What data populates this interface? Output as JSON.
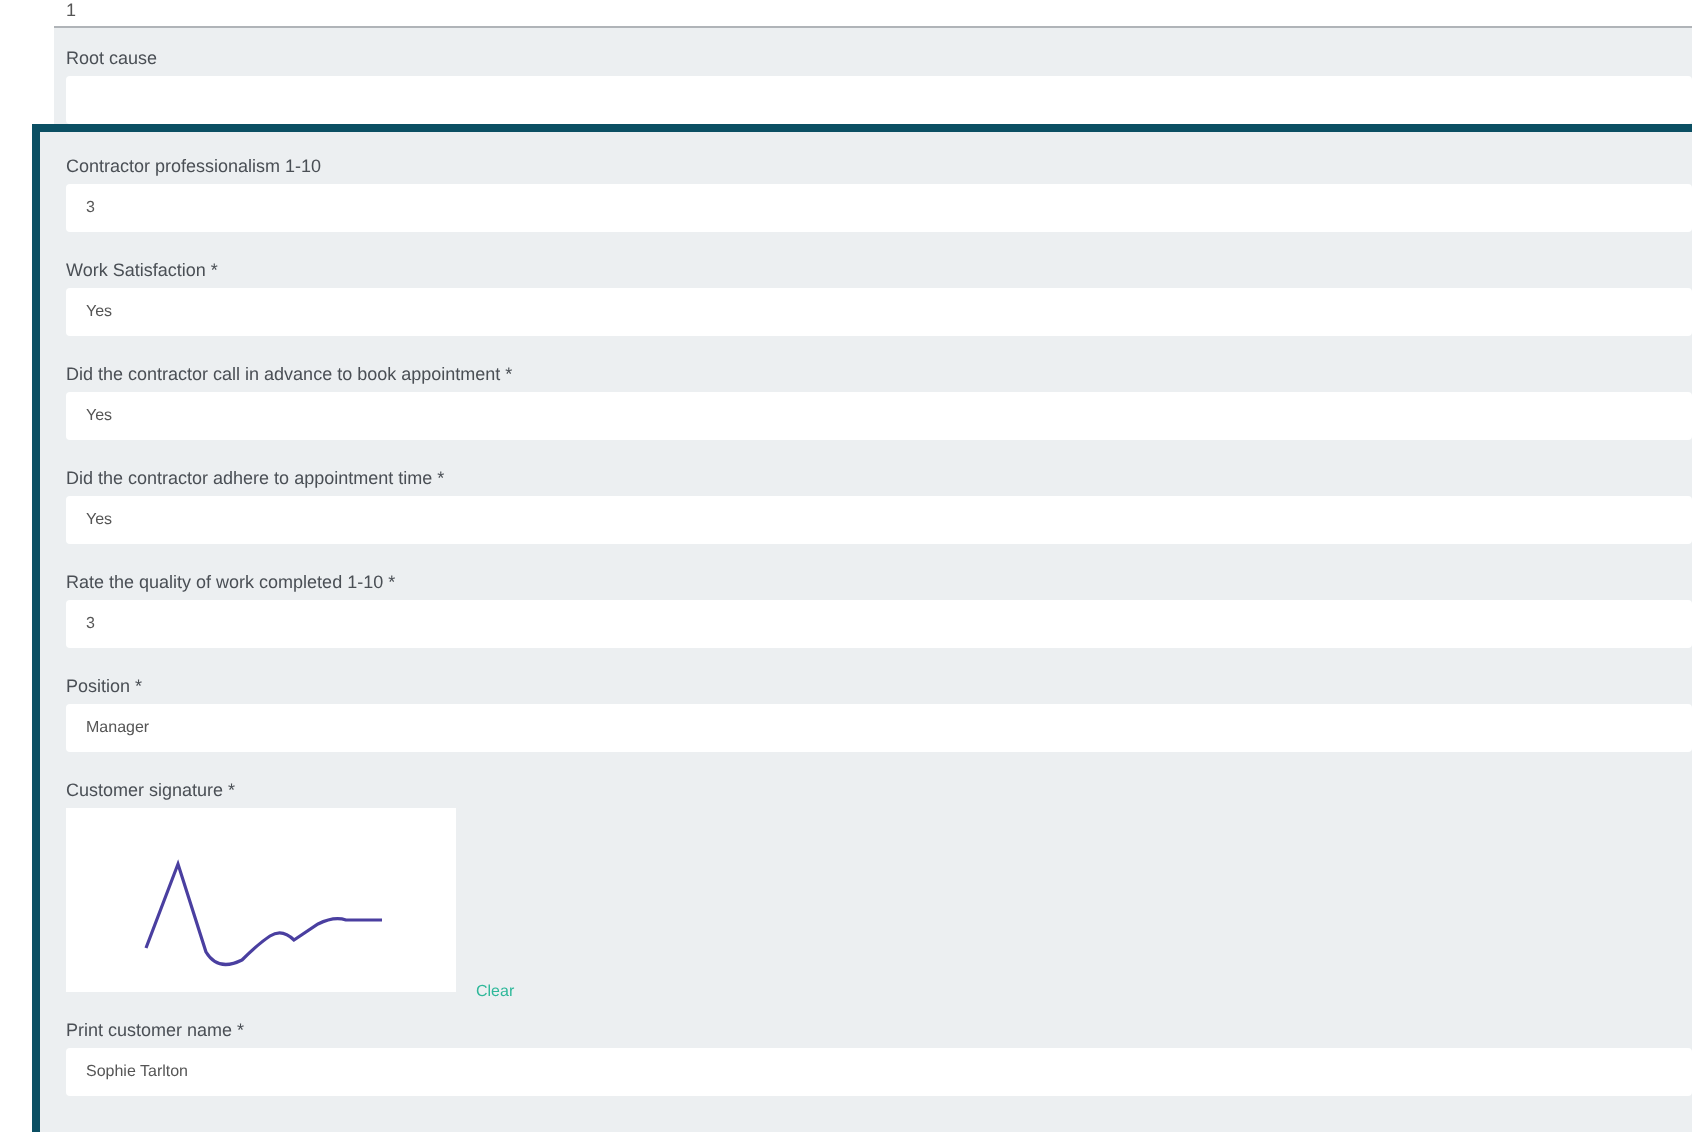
{
  "top_field": {
    "value": "1"
  },
  "fields": [
    {
      "kind": "text",
      "label": "Root cause"
    }
  ],
  "highlighted_section": {
    "fields": [
      {
        "kind": "text",
        "label": "Contractor professionalism 1-10",
        "value": "3"
      },
      {
        "kind": "text",
        "label": "Work Satisfaction *",
        "value": "Yes"
      },
      {
        "kind": "text",
        "label": "Did the contractor call in advance to book appointment *",
        "value": "Yes"
      },
      {
        "kind": "text",
        "label": "Did the contractor adhere to appointment time *",
        "value": "Yes"
      },
      {
        "kind": "text",
        "label": "Rate the quality of work completed 1-10 *",
        "value": "3"
      },
      {
        "kind": "text",
        "label": "Position *",
        "value": "Manager"
      },
      {
        "kind": "signature",
        "label": "Customer signature *",
        "clear_link": "Clear"
      },
      {
        "kind": "text",
        "label": "Print customer name *",
        "value": "Sophie Tarlton"
      }
    ]
  }
}
